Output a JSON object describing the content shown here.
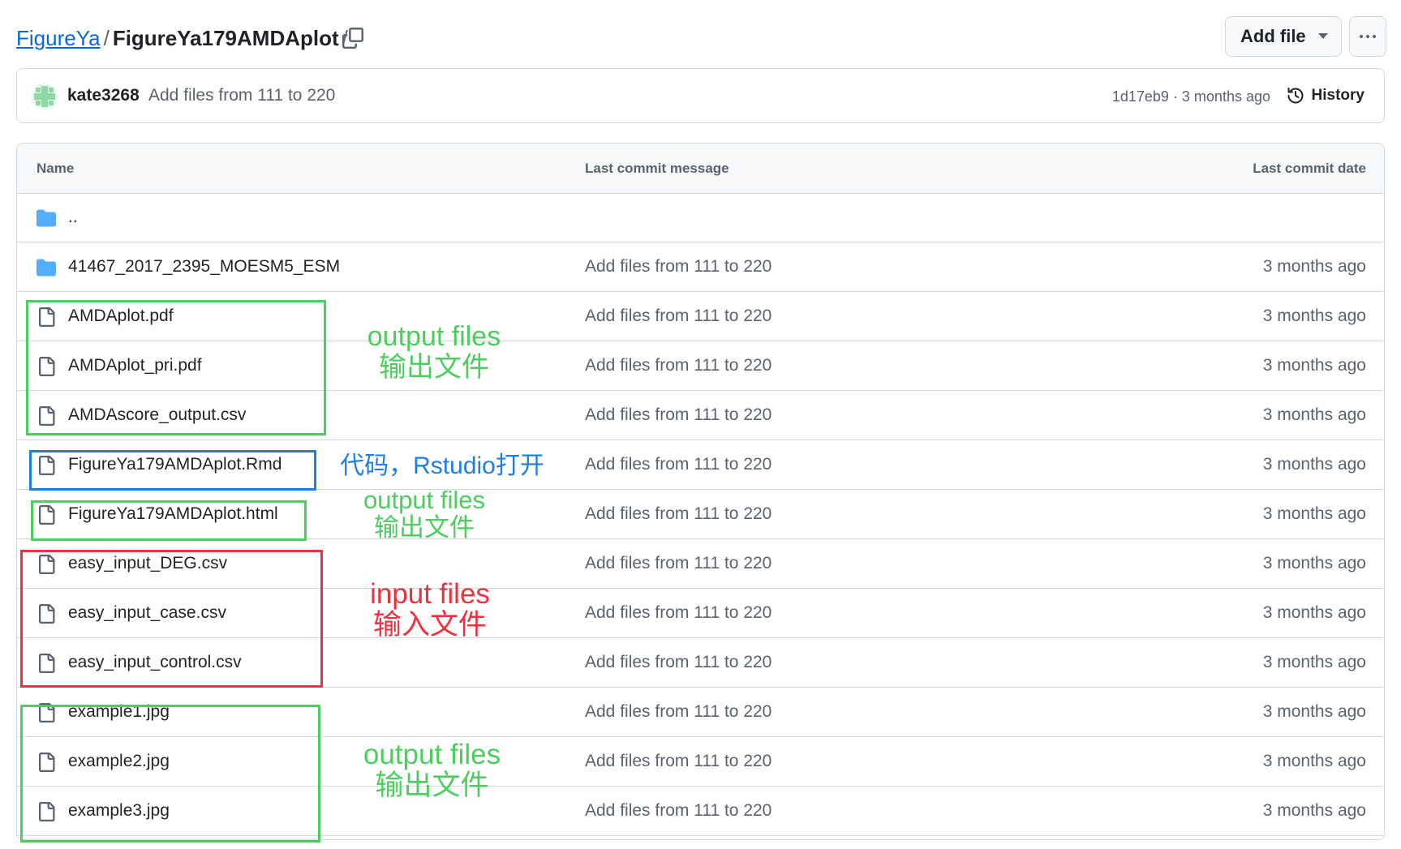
{
  "breadcrumb": {
    "org": "FigureYa",
    "separator": "/",
    "repo": "FigureYa179AMDAplot",
    "trailing": "/"
  },
  "actions": {
    "add_file": "Add file",
    "more": "more-options"
  },
  "commit": {
    "author": "kate3268",
    "message": "Add files from 111 to 220",
    "hash_time": "1d17eb9 · 3 months ago",
    "history": "History"
  },
  "table": {
    "headers": {
      "name": "Name",
      "message": "Last commit message",
      "date": "Last commit date"
    },
    "rows": [
      {
        "type": "folder",
        "name": "..",
        "message": "",
        "date": ""
      },
      {
        "type": "folder",
        "name": "41467_2017_2395_MOESM5_ESM",
        "message": "Add files from 111 to 220",
        "date": "3 months ago"
      },
      {
        "type": "file",
        "name": "AMDAplot.pdf",
        "message": "Add files from 111 to 220",
        "date": "3 months ago"
      },
      {
        "type": "file",
        "name": "AMDAplot_pri.pdf",
        "message": "Add files from 111 to 220",
        "date": "3 months ago"
      },
      {
        "type": "file",
        "name": "AMDAscore_output.csv",
        "message": "Add files from 111 to 220",
        "date": "3 months ago"
      },
      {
        "type": "file",
        "name": "FigureYa179AMDAplot.Rmd",
        "message": "Add files from 111 to 220",
        "date": "3 months ago"
      },
      {
        "type": "file",
        "name": "FigureYa179AMDAplot.html",
        "message": "Add files from 111 to 220",
        "date": "3 months ago"
      },
      {
        "type": "file",
        "name": "easy_input_DEG.csv",
        "message": "Add files from 111 to 220",
        "date": "3 months ago"
      },
      {
        "type": "file",
        "name": "easy_input_case.csv",
        "message": "Add files from 111 to 220",
        "date": "3 months ago"
      },
      {
        "type": "file",
        "name": "easy_input_control.csv",
        "message": "Add files from 111 to 220",
        "date": "3 months ago"
      },
      {
        "type": "file",
        "name": "example1.jpg",
        "message": "Add files from 111 to 220",
        "date": "3 months ago"
      },
      {
        "type": "file",
        "name": "example2.jpg",
        "message": "Add files from 111 to 220",
        "date": "3 months ago"
      },
      {
        "type": "file",
        "name": "example3.jpg",
        "message": "Add files from 111 to 220",
        "date": "3 months ago"
      }
    ]
  },
  "annotations": {
    "output1": {
      "line1": "output files",
      "line2": "输出文件",
      "color": "#4ccd5e"
    },
    "code": {
      "line1": "代码，Rstudio打开",
      "color": "#1f7ee0"
    },
    "output2": {
      "line1": "output files",
      "line2": "输出文件",
      "color": "#4ccd5e"
    },
    "input": {
      "line1": "input files",
      "line2": "输入文件",
      "color": "#f0303c"
    },
    "output3": {
      "line1": "output files",
      "line2": "输出文件",
      "color": "#4ccd5e"
    }
  },
  "icons": {
    "folder": "folder-icon",
    "file": "file-icon",
    "copy": "copy-icon",
    "history": "history-icon"
  }
}
